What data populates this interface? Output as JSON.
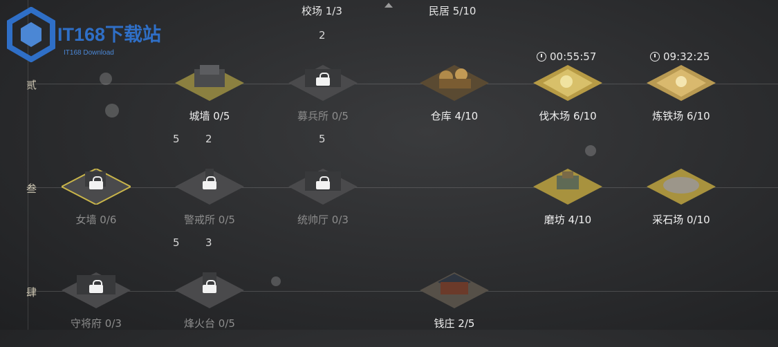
{
  "logo": {
    "title": "IT168下载站",
    "subtitle": "IT168 Download"
  },
  "top": {
    "left_label": "校场 1/3",
    "right_label": "民居 5/10",
    "count": "2"
  },
  "rows": {
    "r2": "贰",
    "r3": "叁",
    "r4": "肆"
  },
  "counts": {
    "c1": "5",
    "c2": "2",
    "c3": "5",
    "c4": "5",
    "c5": "3"
  },
  "timers": {
    "t1": "00:55:57",
    "t2": "09:32:25"
  },
  "buildings": {
    "chengqiang": "城墙 0/5",
    "mubingsuo": "募兵所 0/5",
    "cangku": "仓库 4/10",
    "famuchang": "伐木场 6/10",
    "liantiechang": "炼铁场 6/10",
    "nvqiang": "女墙 0/6",
    "jingjiesuo": "警戒所 0/5",
    "tongshuaiting": "统帅厅 0/3",
    "mofang": "磨坊 4/10",
    "caishichang": "采石场 0/10",
    "shoujiangfu": "守将府 0/3",
    "fenghuotai": "烽火台 0/5",
    "qianzhuang": "钱庄 2/5"
  },
  "colors": {
    "logo_blue": "#2f6fc7",
    "gold_glow": "#e3c45a",
    "locked_gray": "#8d8d8d"
  }
}
